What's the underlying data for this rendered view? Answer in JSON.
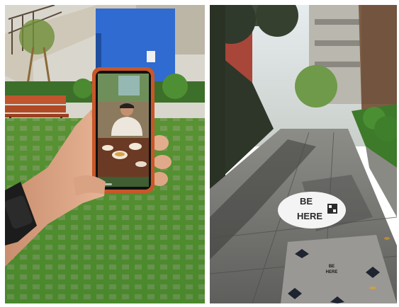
{
  "left_photo": {
    "colors": {
      "wall_blue": "#2f6bd0",
      "grass": "#4f8f2f",
      "bench": "#c0552e",
      "phone_case": "#c8572a"
    }
  },
  "right_photo": {
    "disc": {
      "line1": "BE",
      "line2": "HERE"
    },
    "plaque": {
      "line1": "BE",
      "line2": "HERE"
    },
    "colors": {
      "pavement": "#6e6e6e",
      "hedge": "#3d7a2a",
      "disc_fill": "#f4f4f4"
    }
  }
}
